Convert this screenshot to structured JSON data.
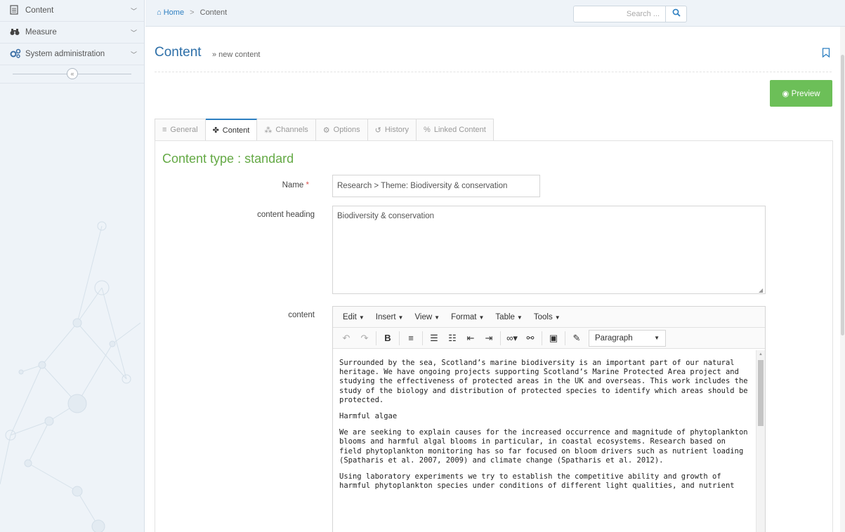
{
  "sidebar": {
    "items": [
      {
        "label": "Content",
        "icon": "document-icon"
      },
      {
        "label": "Measure",
        "icon": "binoculars-icon"
      },
      {
        "label": "System administration",
        "icon": "gears-icon"
      }
    ],
    "collapse_icon": "«"
  },
  "topbar": {
    "breadcrumb": {
      "home": "Home",
      "sep": ">",
      "current": "Content"
    },
    "search_placeholder": "Search ..."
  },
  "header": {
    "title": "Content",
    "subtitle": "» new content",
    "preview_label": "Preview"
  },
  "tabs": [
    {
      "label": "General",
      "icon": "≡"
    },
    {
      "label": "Content",
      "icon": "✤"
    },
    {
      "label": "Channels",
      "icon": "⁂"
    },
    {
      "label": "Options",
      "icon": "⚙"
    },
    {
      "label": "History",
      "icon": "↺"
    },
    {
      "label": "Linked Content",
      "icon": "%"
    }
  ],
  "form": {
    "content_type": "Content type : standard",
    "name_label": "Name",
    "name_required": "*",
    "name_value": "Research > Theme: Biodiversity & conservation",
    "heading_label": "content heading",
    "heading_value": "Biodiversity & conservation",
    "content_label": "content"
  },
  "editor": {
    "menus": [
      "Edit",
      "Insert",
      "View",
      "Format",
      "Table",
      "Tools"
    ],
    "format_value": "Paragraph",
    "paragraphs": [
      "Surrounded by the sea, Scotland’s marine biodiversity is an important part of our natural heritage.  We have ongoing projects supporting Scotland’s Marine Protected Area project and studying the effectiveness of protected areas in the UK and overseas. This work includes the study of the biology and distribution of protected species to identify which areas should be protected.",
      "Harmful algae",
      "We are seeking to explain causes for the increased occurrence and magnitude of phytoplankton blooms and harmful algal blooms in particular, in coastal ecosystems. Research based on field phytoplankton monitoring has so far focused on bloom drivers such as nutrient loading (Spatharis et al. 2007, 2009) and climate change (Spatharis et al. 2012).",
      "Using laboratory experiments we try to establish the competitive ability and growth of harmful phytoplankton species under conditions of different light qualities, and nutrient"
    ]
  }
}
